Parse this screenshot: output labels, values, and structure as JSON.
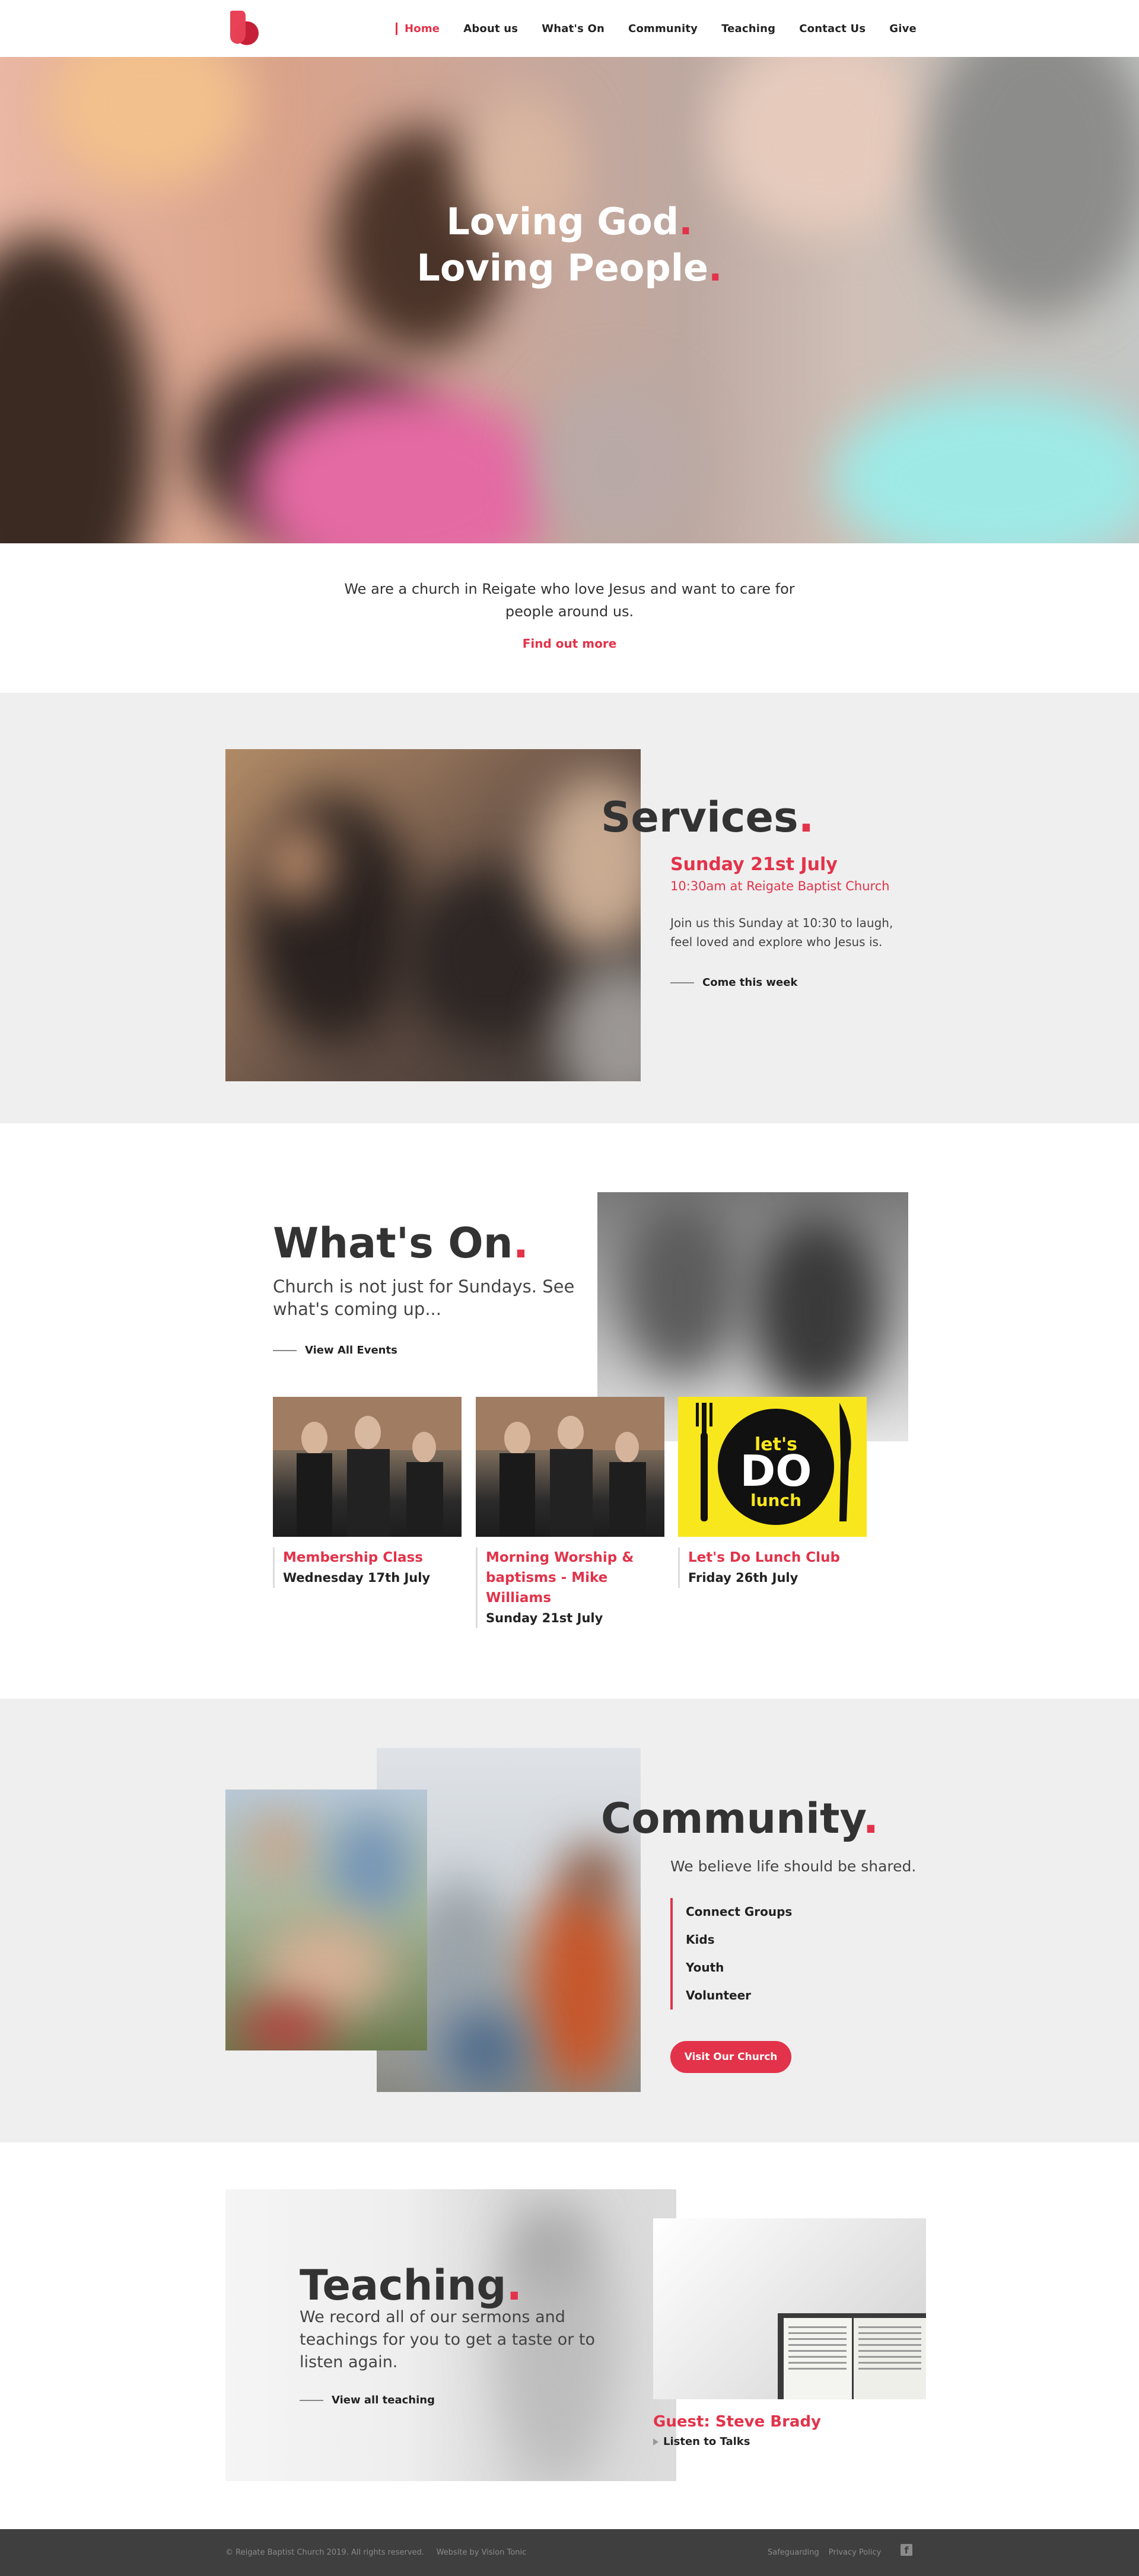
{
  "colors": {
    "accent": "#e2334a",
    "grey_band": "#efefef",
    "footer_bg": "#3f3f3f",
    "dark_text": "#333333"
  },
  "nav": {
    "items": [
      {
        "label": "Home",
        "active": true
      },
      {
        "label": "About us"
      },
      {
        "label": "What's On"
      },
      {
        "label": "Community"
      },
      {
        "label": "Teaching"
      },
      {
        "label": "Contact Us"
      },
      {
        "label": "Give"
      }
    ]
  },
  "hero": {
    "line1": "Loving God",
    "line2": "Loving People",
    "dot": "."
  },
  "intro": {
    "text": "We are a church in Reigate who love Jesus and want to care for people around us.",
    "link": "Find out more"
  },
  "services": {
    "title": "Services",
    "date": "Sunday 21st July",
    "time": "10:30am at Reigate Baptist Church",
    "description": "Join us this Sunday at 10:30 to laugh, feel loved and explore who Jesus is.",
    "link": "Come this week"
  },
  "whats_on": {
    "title": "What's On",
    "subtitle": "Church is not just for Sundays. See what's coming up...",
    "link": "View All Events",
    "events": [
      {
        "title": "Membership Class",
        "date": "Wednesday 17th July"
      },
      {
        "title": "Morning Worship & baptisms - Mike Williams",
        "date": "Sunday 21st July"
      },
      {
        "title": "Let's Do Lunch Club",
        "date": "Friday 26th July"
      }
    ],
    "lunch_logo": {
      "line1": "let's",
      "line2": "DO",
      "line3": "lunch"
    }
  },
  "community": {
    "title": "Community",
    "subtitle": "We believe life should be shared.",
    "items": [
      "Connect Groups",
      "Kids",
      "Youth",
      "Volunteer"
    ],
    "button": "Visit Our Church"
  },
  "teaching": {
    "title": "Teaching",
    "description": "We record all of our sermons and teachings for you to get a taste or to listen again.",
    "link": "View all teaching",
    "guest": "Guest: Steve Brady",
    "listen": "Listen to Talks"
  },
  "footer": {
    "copyright": "© Reigate Baptist Church 2019. All rights reserved.",
    "credit": "Website by Vision Tonic",
    "links": [
      "Safeguarding",
      "Privacy Policy"
    ],
    "social_icon": "facebook-icon"
  }
}
